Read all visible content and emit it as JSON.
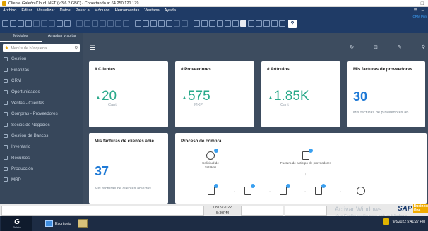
{
  "window": {
    "title": "Cliente Galeón Cloud .NET (v.3.6.2 GBC) - Conectando a: 64.250.121.179",
    "minimize": "–",
    "maximize": "□"
  },
  "menu": {
    "items": [
      "Archivo",
      "Editar",
      "Visualizar",
      "Datos",
      "Pasar a",
      "Módulos",
      "Herramientas",
      "Ventana",
      "Ayuda"
    ],
    "right": [
      "☰",
      "–"
    ]
  },
  "toolbar": {
    "help_label": "?",
    "corner_text": "CRM Prin"
  },
  "sidebar": {
    "tabs": [
      "Módulos",
      "Arrastrar y soltar"
    ],
    "search_placeholder": "Menús de búsqueda",
    "items": [
      "Gestión",
      "Finanzas",
      "CRM",
      "Oportunidades",
      "Ventas - Clientes",
      "Compras - Proveedores",
      "Socios de Negocios",
      "Gestión de Bancos",
      "Inventario",
      "Recursos",
      "Producción",
      "MRP"
    ]
  },
  "dashboard": {
    "cards": {
      "clientes": {
        "title": "# Clientes",
        "value": "20",
        "unit": "Cant"
      },
      "proveedores": {
        "title": "# Proveedores",
        "value": "575",
        "unit": "MXP"
      },
      "articulos": {
        "title": "# Artículos",
        "value": "1.85K",
        "unit": "Cant"
      },
      "facturas_proveedores": {
        "title": "Mis facturas de proveedores...",
        "value": "30",
        "subtitle": "Mis facturas de proveedores ab..."
      },
      "facturas_clientes": {
        "title": "Mis facturas de clientes abie...",
        "value": "37",
        "subtitle": "Mis facturas de clientes abiertas"
      },
      "proceso_compra": {
        "title": "Proceso de compra",
        "nodes": [
          "Solicitud de compra",
          "Factura de anticipo de proveedores"
        ]
      }
    },
    "dots": "....."
  },
  "statusbar": {
    "date": "08/09/2022",
    "time": "5:39PM",
    "activate_title": "Activar Windows",
    "activate_sub": "Ve a Configuración para activar Windows.",
    "sap": "SAP",
    "sap_one": "Business One"
  },
  "taskbar": {
    "start_logo": "G",
    "start_text": "Galeón",
    "desktop_label": "Escritorio",
    "clock": "9/8/2022 5:41:27 PM"
  }
}
